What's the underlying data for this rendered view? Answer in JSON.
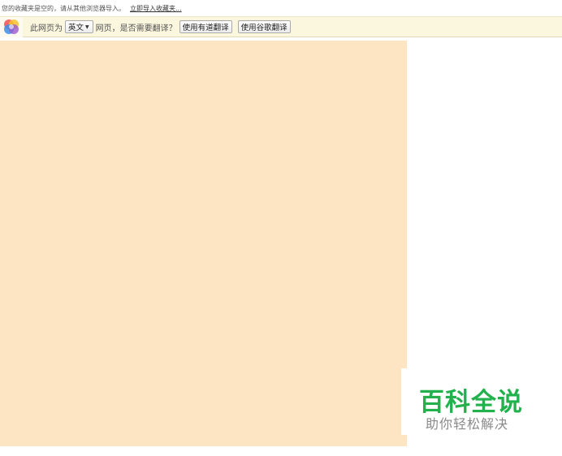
{
  "bookmarks_bar": {
    "empty_message": "您的收藏夹是空的，请从其他浏览器导入。",
    "import_link": "立即导入收藏夹..."
  },
  "translate_bar": {
    "logo_icon": "browser-logo-icon",
    "prefix_text": "此网页为",
    "language_selected": "英文",
    "suffix_text": "网页，是否需要翻译？",
    "youdao_button": "使用有道翻译",
    "google_button": "使用谷歌翻译"
  },
  "content": {
    "panel_color": "#fde5c4"
  },
  "watermark": {
    "title": "百科全说",
    "subtitle": "助你轻松解决",
    "title_color": "#22b14c"
  }
}
